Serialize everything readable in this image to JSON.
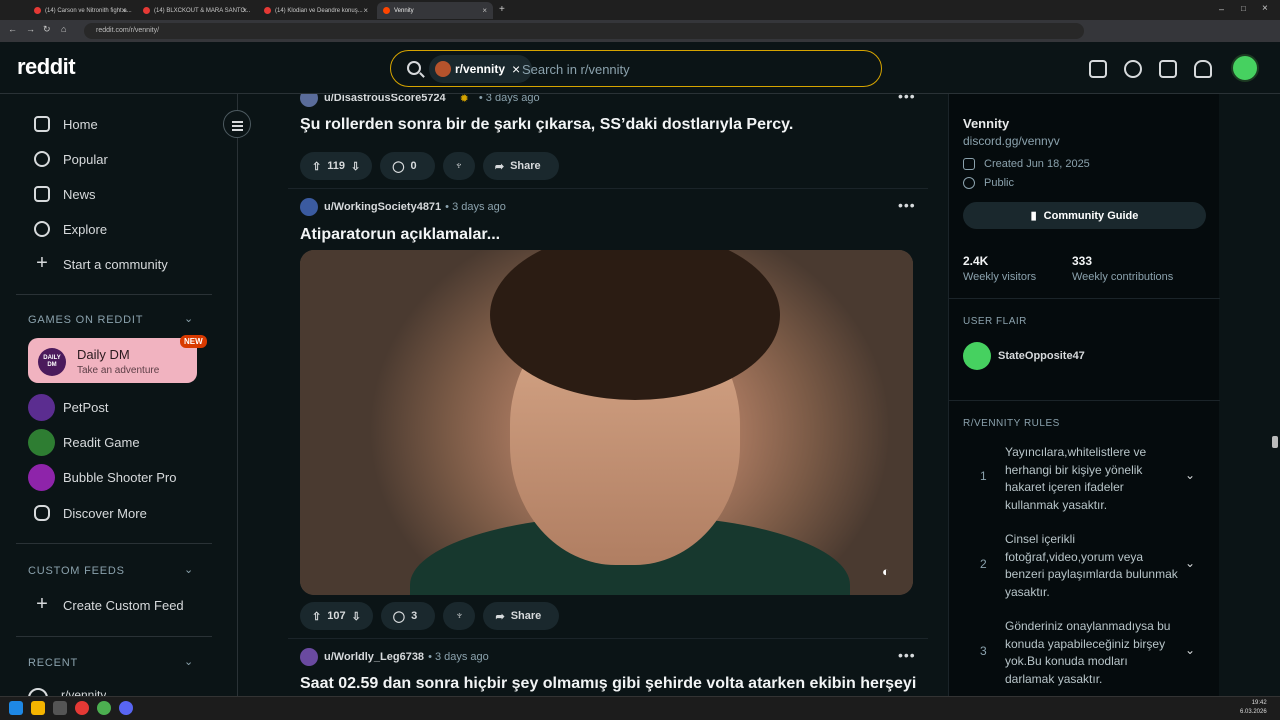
{
  "browser": {
    "tabs": [
      {
        "label": "(14) Carson ve Nitronith fight a..."
      },
      {
        "label": "(14) BLXCKOUT & MARA SANTO..."
      },
      {
        "label": "(14) Klodian ve Deandre konuş..."
      },
      {
        "label": "Vennity"
      }
    ],
    "url": "reddit.com/r/vennity/"
  },
  "header": {
    "logo": "reddit",
    "search_chip": "r/vennity",
    "search_placeholder": "Search in r/vennity"
  },
  "sidebar": {
    "nav": [
      {
        "label": "Home"
      },
      {
        "label": "Popular"
      },
      {
        "label": "News"
      },
      {
        "label": "Explore"
      },
      {
        "label": "Start a community"
      }
    ],
    "games_title": "GAMES ON REDDIT",
    "daily": {
      "title": "Daily DM",
      "sub": "Take an adventure",
      "badge": "NEW",
      "icon_text": "DAILY DM"
    },
    "games": [
      {
        "label": "PetPost",
        "color": "#5b2d90"
      },
      {
        "label": "Readit Game",
        "color": "#2e7d32"
      },
      {
        "label": "Bubble Shooter Pro",
        "color": "#8e24aa"
      },
      {
        "label": "Discover More"
      }
    ],
    "custom_feeds_title": "CUSTOM FEEDS",
    "create_feed": "Create Custom Feed",
    "recent_title": "RECENT",
    "recent_item": "r/vennity"
  },
  "feed": {
    "posts": [
      {
        "user": "u/DisastrousScore5724",
        "time": "• 3 days ago",
        "title": "Şu rollerden sonra bir de şarkı çıkarsa, SS’daki dostlarıyla Percy.",
        "votes": "119",
        "comments": "0",
        "share": "Share"
      },
      {
        "user": "u/WorkingSociety4871",
        "time": "• 3 days ago",
        "title": "Atiparatorun açıklamalar...",
        "votes": "107",
        "comments": "3",
        "share": "Share"
      },
      {
        "user": "u/Worldly_Leg6738",
        "time": "• 3 days ago",
        "title": "Saat 02.59 dan sonra hiçbir şey olmamış gibi şehirde volta atarken ekibin herşeyi"
      }
    ]
  },
  "community": {
    "name": "Vennity",
    "link": "discord.gg/vennyv",
    "created": "Created Jun 18, 2025",
    "visibility": "Public",
    "guide_button": "Community Guide",
    "visitors_value": "2.4K",
    "visitors_label": "Weekly visitors",
    "contributions_value": "333",
    "contributions_label": "Weekly contributions",
    "flair_title": "USER FLAIR",
    "flair_user": "StateOpposite47",
    "rules_title": "R/VENNITY RULES",
    "rules": [
      {
        "n": "1",
        "text": "Yayıncılara,whitelistlere ve herhangi bir kişiye yönelik hakaret içeren ifadeler kullanmak yasaktır."
      },
      {
        "n": "2",
        "text": "Cinsel içerikli fotoğraf,video,yorum veya benzeri paylaşımlarda bulunmak yasaktır."
      },
      {
        "n": "3",
        "text": "Gönderiniz onaylanmadıysa bu konuda yapabileceğiniz birşey yok.Bu konuda modları darlamak yasaktır."
      }
    ]
  },
  "taskbar": {
    "time": "19:42",
    "date": "6.03.2026"
  }
}
